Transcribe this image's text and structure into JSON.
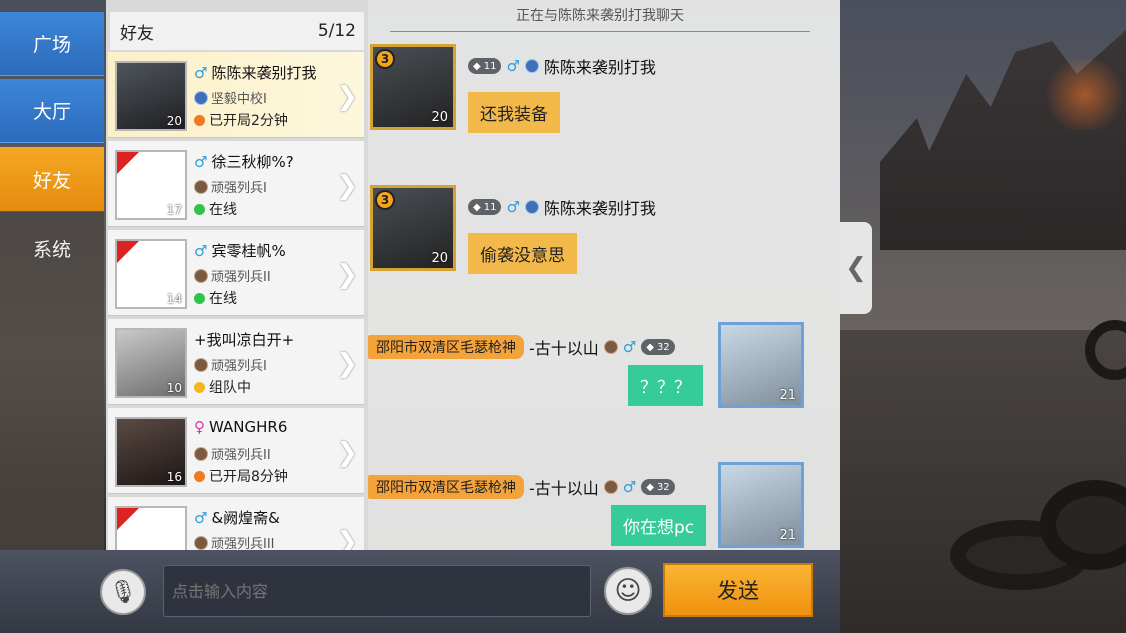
{
  "tabs": [
    {
      "label": "广场"
    },
    {
      "label": "大厅"
    },
    {
      "label": "好友"
    },
    {
      "label": "系统"
    }
  ],
  "friends_panel": {
    "title": "好友",
    "count": "5/12",
    "items": [
      {
        "name": "陈陈来袭别打我",
        "rank": "坚毅中校I",
        "status": "已开局2分钟",
        "level": "20",
        "gender": "♂",
        "status_color": "#f07a20"
      },
      {
        "name": "徐三秋柳%?",
        "rank": "顽强列兵I",
        "status": "在线",
        "level": "17",
        "gender": "♂",
        "status_color": "#32c24a"
      },
      {
        "name": "宾零桂帆%",
        "rank": "顽强列兵II",
        "status": "在线",
        "level": "14",
        "gender": "♂",
        "status_color": "#32c24a"
      },
      {
        "name": "+我叫凉白开+",
        "rank": "顽强列兵I",
        "status": "组队中",
        "level": "10",
        "gender": "",
        "status_color": "#f2b81c"
      },
      {
        "name": "WANGHR6",
        "rank": "顽强列兵II",
        "status": "已开局8分钟",
        "level": "16",
        "gender": "♀",
        "status_color": "#f07a20"
      },
      {
        "name": "&阙煌斋&",
        "rank": "顽强列兵III",
        "status": "",
        "level": "",
        "gender": "♂",
        "status_color": "#32c24a"
      }
    ]
  },
  "chat": {
    "title": "正在与陈陈来袭别打我聊天",
    "messages": [
      {
        "sender": "陈陈来袭别打我",
        "text": "还我装备",
        "avatar_level": "20",
        "pill": "11",
        "badge": "3"
      },
      {
        "sender": "陈陈来袭别打我",
        "text": "偷袭没意思",
        "avatar_level": "20",
        "pill": "11",
        "badge": "3"
      },
      {
        "sender": "-古十以山",
        "tag": "邵阳市双清区毛瑟枪神",
        "text": "？？？",
        "avatar_level": "21",
        "pill": "32"
      },
      {
        "sender": "-古十以山",
        "tag": "邵阳市双清区毛瑟枪神",
        "text": "你在想pc",
        "avatar_level": "21",
        "pill": "32"
      }
    ]
  },
  "input": {
    "placeholder": "点击输入内容"
  },
  "send_label": "发送",
  "icons": {
    "mic": "microphone-icon",
    "emoji": "emoji-icon",
    "handle": "chevron-left-icon"
  }
}
